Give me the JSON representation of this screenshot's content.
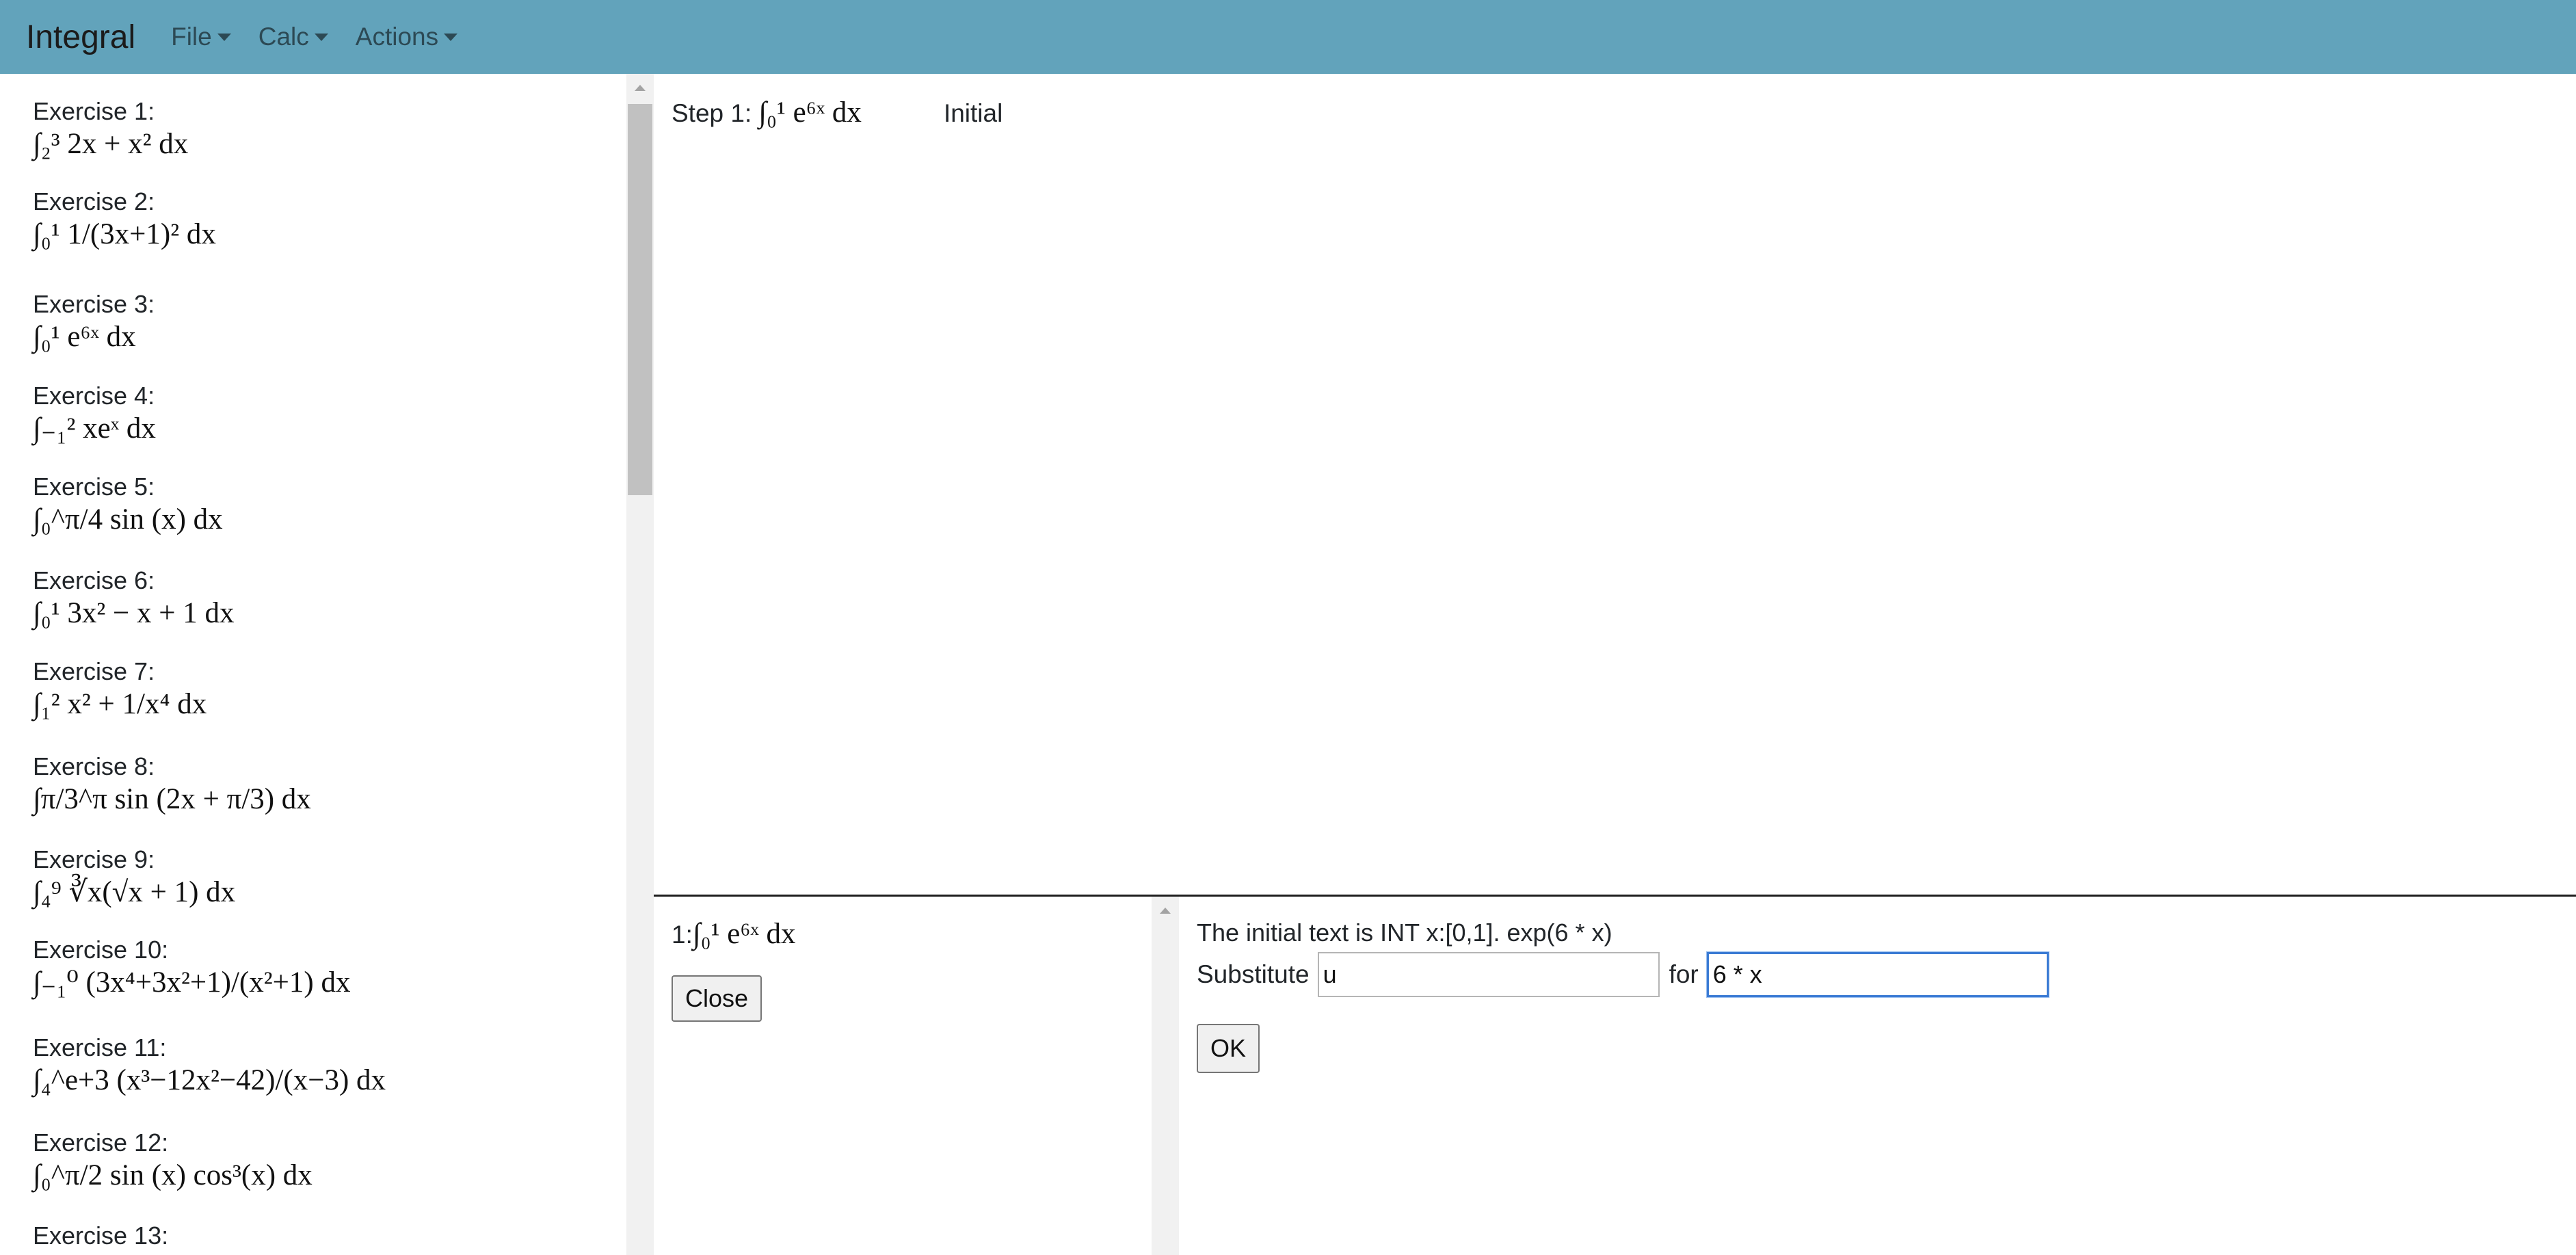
{
  "navbar": {
    "brand": "Integral",
    "menus": [
      {
        "label": "File"
      },
      {
        "label": "Calc"
      },
      {
        "label": "Actions"
      }
    ]
  },
  "exercises": [
    {
      "label": "Exercise 1:",
      "expr": "∫₂³ 2x + x² dx"
    },
    {
      "label": "Exercise 2:",
      "expr": "∫₀¹ 1/(3x+1)² dx"
    },
    {
      "label": "Exercise 3:",
      "expr": "∫₀¹ e⁶ˣ dx"
    },
    {
      "label": "Exercise 4:",
      "expr": "∫₋₁² xeˣ dx"
    },
    {
      "label": "Exercise 5:",
      "expr": "∫₀^π/4 sin (x) dx"
    },
    {
      "label": "Exercise 6:",
      "expr": "∫₀¹ 3x² − x + 1 dx"
    },
    {
      "label": "Exercise 7:",
      "expr": "∫₁² x² + 1/x⁴ dx"
    },
    {
      "label": "Exercise 8:",
      "expr": "∫π/3^π sin (2x + π/3) dx"
    },
    {
      "label": "Exercise 9:",
      "expr": "∫₄⁹ ∛x(√x + 1) dx"
    },
    {
      "label": "Exercise 10:",
      "expr": "∫₋₁⁰ (3x⁴+3x²+1)/(x²+1) dx"
    },
    {
      "label": "Exercise 11:",
      "expr": "∫₄^e+3 (x³−12x²−42)/(x−3) dx"
    },
    {
      "label": "Exercise 12:",
      "expr": "∫₀^π/2 sin (x) cos³(x) dx"
    },
    {
      "label": "Exercise 13:",
      "expr": ""
    }
  ],
  "steps": [
    {
      "label": "Step 1:",
      "expr": "∫₀¹ e⁶ˣ dx",
      "reason": "Initial"
    }
  ],
  "selected": {
    "prefix": "1:",
    "expr": "∫₀¹ e⁶ˣ dx",
    "close_label": "Close"
  },
  "panel": {
    "info": "The initial text is INT x:[0,1]. exp(6 * x)",
    "substitute_label": "Substitute",
    "substitute_value": "u",
    "for_label": "for",
    "for_value": "6 * x",
    "ok_label": "OK"
  },
  "colors": {
    "navbar": "#62a3bb",
    "focus_border": "#3b7bd4"
  }
}
